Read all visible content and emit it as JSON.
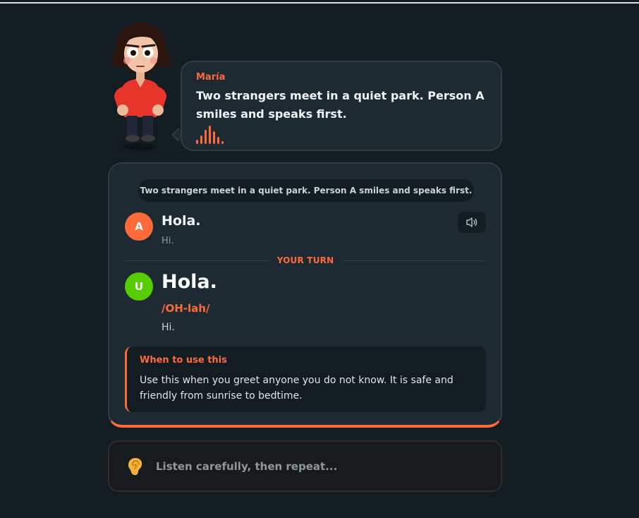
{
  "character": {
    "name": "María",
    "speech": "Two strangers meet in a quiet park. Person A smiles and speaks first."
  },
  "card": {
    "scene": "Two strangers meet in a quiet park. Person A smiles and speaks first.",
    "line_a": {
      "avatar_letter": "A",
      "text": "Hola.",
      "translation": "Hi."
    },
    "turn_label": "YOUR TURN",
    "line_u": {
      "avatar_letter": "U",
      "text": "Hola.",
      "phonetic": "/OH-lah/",
      "translation": "Hi."
    },
    "note": {
      "title": "When to use this",
      "body": "Use this when you greet anyone you do not know. It is safe and friendly from sunrise to bedtime."
    }
  },
  "listen": {
    "icon": "ear-icon",
    "text": "Listen carefully, then repeat..."
  },
  "colors": {
    "accent": "#ff6a3a",
    "user_avatar": "#58cc02",
    "background": "#131c21",
    "card": "#1e2a31"
  }
}
